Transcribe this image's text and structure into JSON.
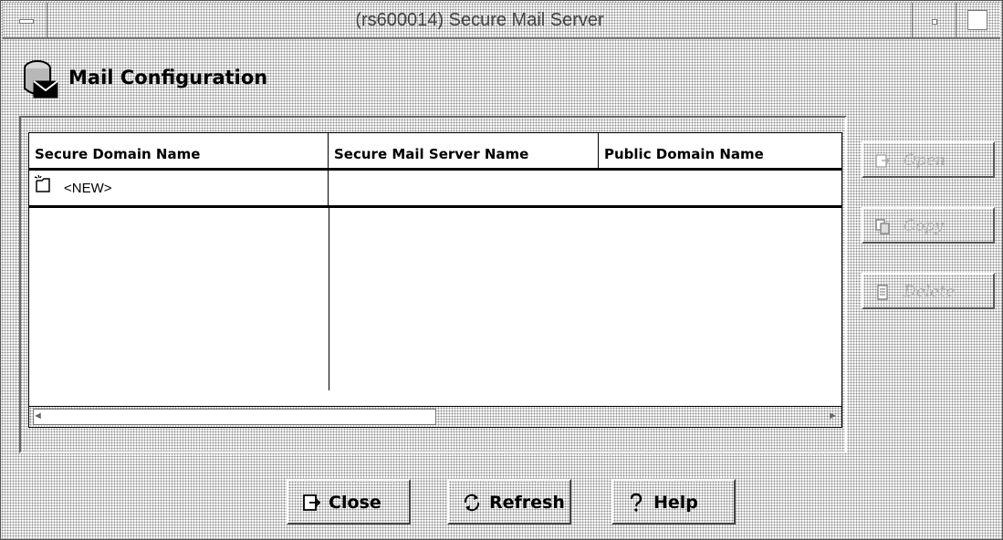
{
  "window": {
    "title": "(rs600014) Secure Mail Server"
  },
  "header": {
    "title": "Mail Configuration"
  },
  "table": {
    "columns": [
      "Secure Domain Name",
      "Secure Mail Server Name",
      "Public Domain Name"
    ],
    "rows": [
      {
        "domain": "<NEW>",
        "server": "",
        "public": ""
      }
    ]
  },
  "side_buttons": {
    "open": "Open",
    "copy": "Copy",
    "delete": "Delete"
  },
  "bottom_buttons": {
    "close": "Close",
    "refresh": "Refresh",
    "help": "Help"
  },
  "icons": {
    "header": "mail-server-icon",
    "new_row": "new-item-icon",
    "open": "open-icon",
    "copy": "copy-icon",
    "delete": "delete-icon",
    "close": "close-icon",
    "refresh": "refresh-icon",
    "help": "help-icon"
  }
}
